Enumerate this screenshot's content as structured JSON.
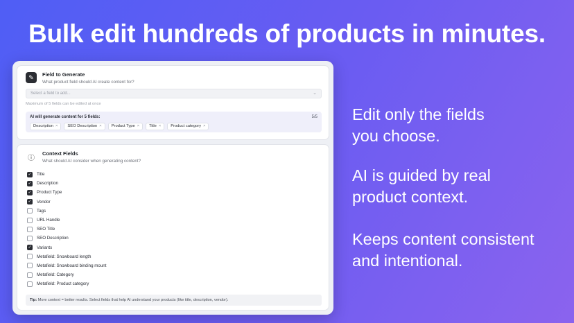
{
  "headline": "Bulk edit hundreds of products in minutes.",
  "field_to_generate": {
    "title": "Field to Generate",
    "subtitle": "What product field should AI create content for?",
    "select_placeholder": "Select a field to add...",
    "max_note": "Maximum of 5 fields can be edited at once",
    "generate_title": "AI will generate content for 5 fields:",
    "count": "5/5",
    "tags": [
      "Description",
      "SEO Description",
      "Product Type",
      "Title",
      "Product category"
    ]
  },
  "context_fields": {
    "title": "Context Fields",
    "subtitle": "What should AI consider when generating content?",
    "items": [
      {
        "label": "Title",
        "checked": true
      },
      {
        "label": "Description",
        "checked": true
      },
      {
        "label": "Product Type",
        "checked": true
      },
      {
        "label": "Vendor",
        "checked": true
      },
      {
        "label": "Tags",
        "checked": false
      },
      {
        "label": "URL Handle",
        "checked": false
      },
      {
        "label": "SEO Title",
        "checked": false
      },
      {
        "label": "SEO Description",
        "checked": false
      },
      {
        "label": "Variants",
        "checked": true
      },
      {
        "label": "Metafield: Snowboard length",
        "checked": false
      },
      {
        "label": "Metafield: Snowboard binding mount",
        "checked": false
      },
      {
        "label": "Metafield: Category",
        "checked": false
      },
      {
        "label": "Metafield: Product category",
        "checked": false
      }
    ],
    "tip_label": "Tip:",
    "tip_text": "More context = better results. Select fields that help AI understand your products (like title, description, vendor)."
  },
  "bullets": [
    "Edit only the fields you choose.",
    "AI is guided by real product context.",
    "Keeps content consistent and intentional."
  ],
  "bullet_lines": [
    [
      "Edit only the fields",
      "you choose."
    ],
    [
      "AI is guided by real",
      "product context."
    ],
    [
      "Keeps content consistent",
      "and intentional."
    ]
  ],
  "icons": {
    "field_icon": "pencil-icon",
    "context_icon": "info-icon",
    "select_chevron": "chevron-icon",
    "tag_remove": "close-icon",
    "check": "checkmark-icon"
  }
}
